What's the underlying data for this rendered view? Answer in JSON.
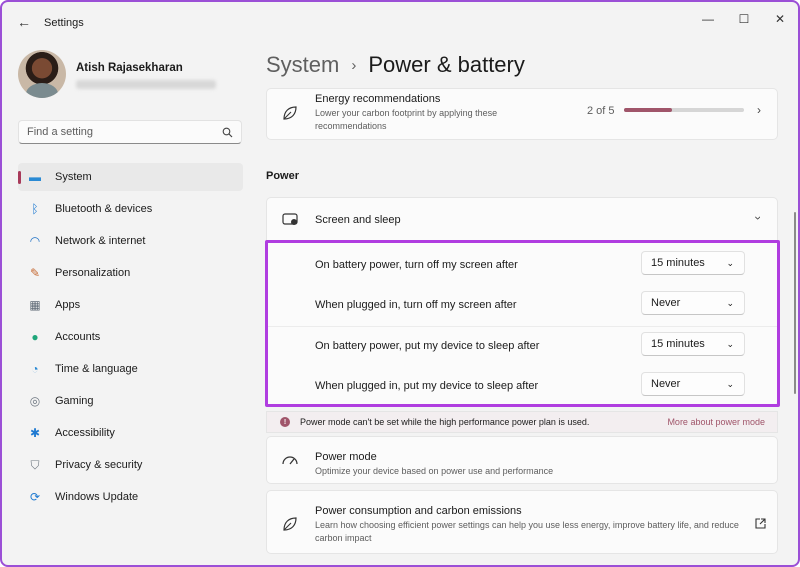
{
  "window": {
    "title": "Settings",
    "back_icon": "back-arrow-icon",
    "controls": {
      "minimize": "—",
      "maximize": "☐",
      "close": "✕"
    }
  },
  "profile": {
    "name": "Atish Rajasekharan"
  },
  "search": {
    "placeholder": "Find a setting",
    "icon": "search-icon"
  },
  "nav": {
    "items": [
      {
        "label": "System",
        "icon": "system-icon",
        "glyph": "▬",
        "color": "#2a8ad4",
        "active": true
      },
      {
        "label": "Bluetooth & devices",
        "icon": "bluetooth-icon",
        "glyph": "ᛒ",
        "color": "#1f7ad1"
      },
      {
        "label": "Network & internet",
        "icon": "wifi-icon",
        "glyph": "◠",
        "color": "#1c6fc4"
      },
      {
        "label": "Personalization",
        "icon": "brush-icon",
        "glyph": "✎",
        "color": "#c5672f"
      },
      {
        "label": "Apps",
        "icon": "apps-icon",
        "glyph": "▦",
        "color": "#5f6a76"
      },
      {
        "label": "Accounts",
        "icon": "accounts-icon",
        "glyph": "●",
        "color": "#1fa67a"
      },
      {
        "label": "Time & language",
        "icon": "globe-clock-icon",
        "glyph": "◔",
        "color": "#2a8ad4"
      },
      {
        "label": "Gaming",
        "icon": "gamepad-icon",
        "glyph": "◎",
        "color": "#6d7680"
      },
      {
        "label": "Accessibility",
        "icon": "accessibility-icon",
        "glyph": "✱",
        "color": "#1f7ad1"
      },
      {
        "label": "Privacy & security",
        "icon": "shield-icon",
        "glyph": "⛉",
        "color": "#6f7880"
      },
      {
        "label": "Windows Update",
        "icon": "update-icon",
        "glyph": "⟳",
        "color": "#1f7ad1"
      }
    ]
  },
  "breadcrumb": {
    "root": "System",
    "separator": "›",
    "current": "Power & battery"
  },
  "energy": {
    "title": "Energy recommendations",
    "desc": "Lower your carbon footprint by applying these recommendations",
    "progress_text": "2 of 5",
    "progress_fraction": 0.4,
    "icon": "leaf-icon"
  },
  "power_section": {
    "label": "Power"
  },
  "screen_sleep": {
    "title": "Screen and sleep",
    "icon": "screen-sleep-icon",
    "rows": [
      {
        "label": "On battery power, turn off my screen after",
        "value": "15 minutes"
      },
      {
        "label": "When plugged in, turn off my screen after",
        "value": "Never"
      },
      {
        "label": "On battery power, put my device to sleep after",
        "value": "15 minutes"
      },
      {
        "label": "When plugged in, put my device to sleep after",
        "value": "Never"
      }
    ]
  },
  "warning": {
    "text": "Power mode can't be set while the high performance power plan is used.",
    "link": "More about power mode"
  },
  "power_mode": {
    "title": "Power mode",
    "desc": "Optimize your device based on power use and performance",
    "icon": "gauge-icon"
  },
  "power_consumption": {
    "title": "Power consumption and carbon emissions",
    "desc": "Learn how choosing efficient power settings can help you use less energy, improve battery life, and reduce carbon impact",
    "icon": "leaf-icon"
  },
  "colors": {
    "accent": "#a0556a",
    "highlight": "#b03de0"
  }
}
